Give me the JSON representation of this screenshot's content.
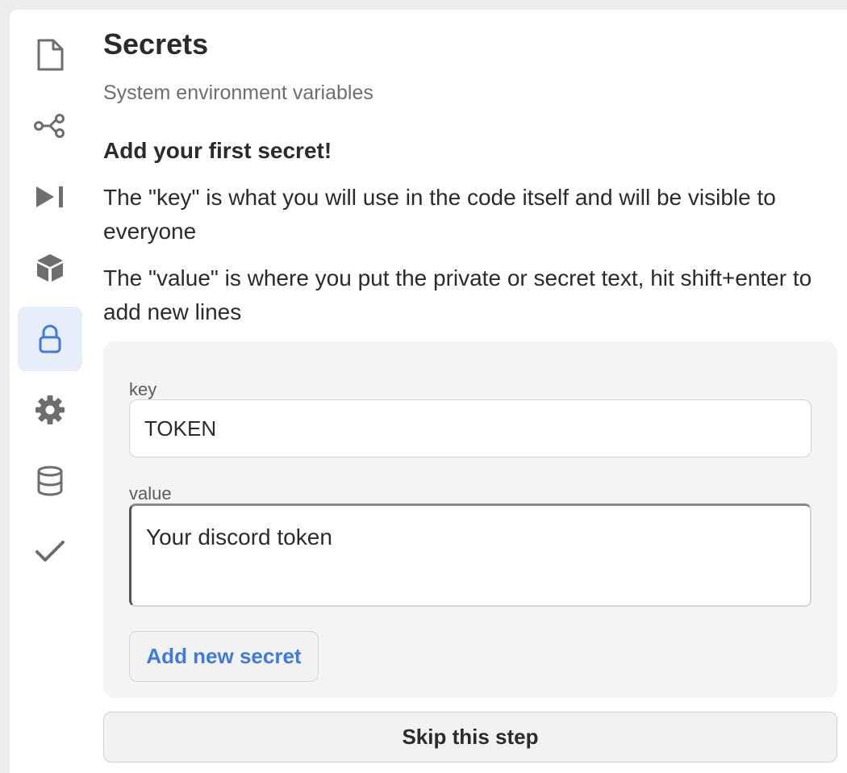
{
  "sidebar": {
    "items": [
      {
        "icon": "document-icon",
        "active": false
      },
      {
        "icon": "share-nodes-icon",
        "active": false
      },
      {
        "icon": "skip-forward-icon",
        "active": false
      },
      {
        "icon": "cube-icon",
        "active": false
      },
      {
        "icon": "lock-icon",
        "active": true
      },
      {
        "icon": "gear-icon",
        "active": false
      },
      {
        "icon": "database-icon",
        "active": false
      },
      {
        "icon": "checkmark-icon",
        "active": false
      }
    ]
  },
  "main": {
    "title": "Secrets",
    "subtitle": "System environment variables",
    "heading": "Add your first secret!",
    "paragraph_key": "The \"key\" is what you will use in the code itself and will be visible to everyone",
    "paragraph_value": "The \"value\" is where you put the private or secret text, hit shift+enter to add new lines",
    "form": {
      "key_label": "key",
      "key_value": "TOKEN",
      "value_label": "value",
      "value_value": "Your discord token",
      "add_button_label": "Add new secret"
    },
    "skip_button_label": "Skip this step"
  },
  "colors": {
    "accent": "#3f7bd8",
    "active_nav_background": "#e8eef9",
    "icon_gray": "#6e6e6e",
    "card_background": "#f4f4f4"
  }
}
